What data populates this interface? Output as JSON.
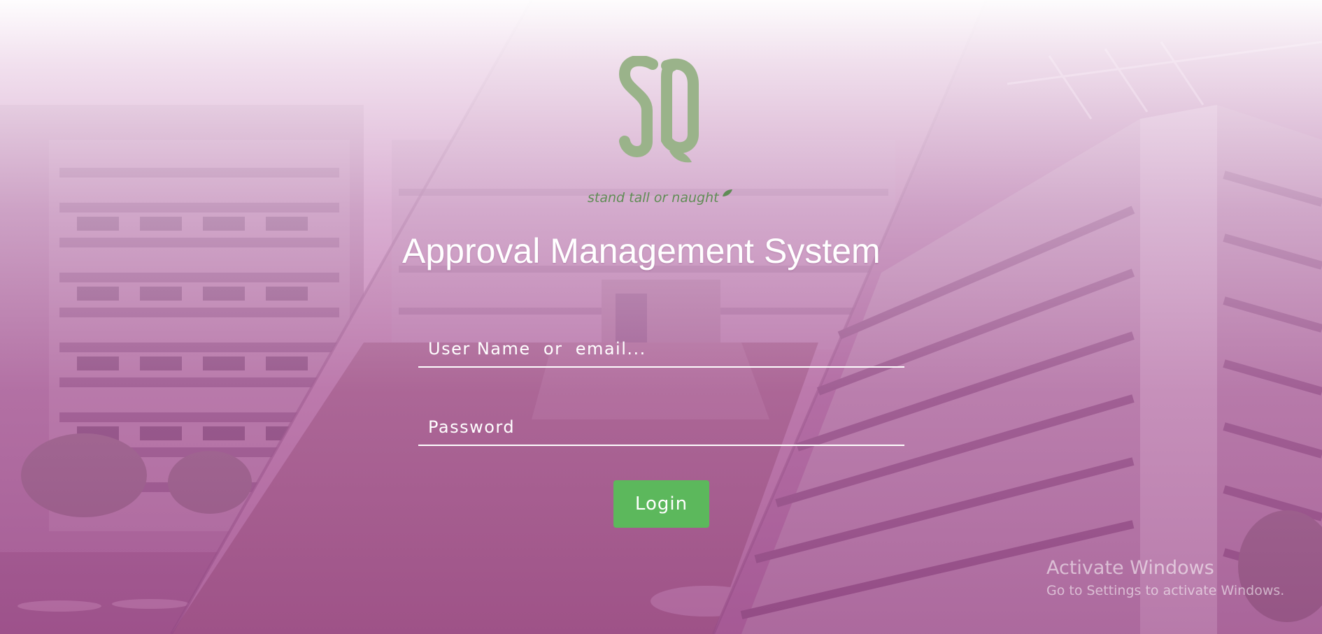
{
  "brand": {
    "logo_text": "SQ",
    "tagline": "stand tall or naught",
    "logo_color": "#9ab38a",
    "tagline_color": "#5f8c55"
  },
  "page_title": "Approval Management System",
  "login_form": {
    "username": {
      "placeholder": "User Name  or  email...",
      "value": ""
    },
    "password": {
      "placeholder": "Password",
      "value": ""
    },
    "login_label": "Login",
    "button_color": "#5cb85c"
  },
  "windows_watermark": {
    "title": "Activate Windows",
    "subtitle": "Go to Settings to activate Windows."
  },
  "theme": {
    "overlay_color": "#b0719f",
    "text_color": "#ffffff"
  }
}
